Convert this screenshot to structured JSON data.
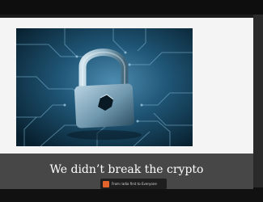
{
  "slide": {
    "image_alt": "Padlock on circuit board",
    "caption": "We didn’t break the crypto"
  },
  "notification": {
    "icon": "app-icon",
    "text": "From radio first to Everyone"
  },
  "colors": {
    "caption_band": "#474747",
    "slide_bg": "#f4f4f4",
    "toast_icon": "#e3642b"
  }
}
